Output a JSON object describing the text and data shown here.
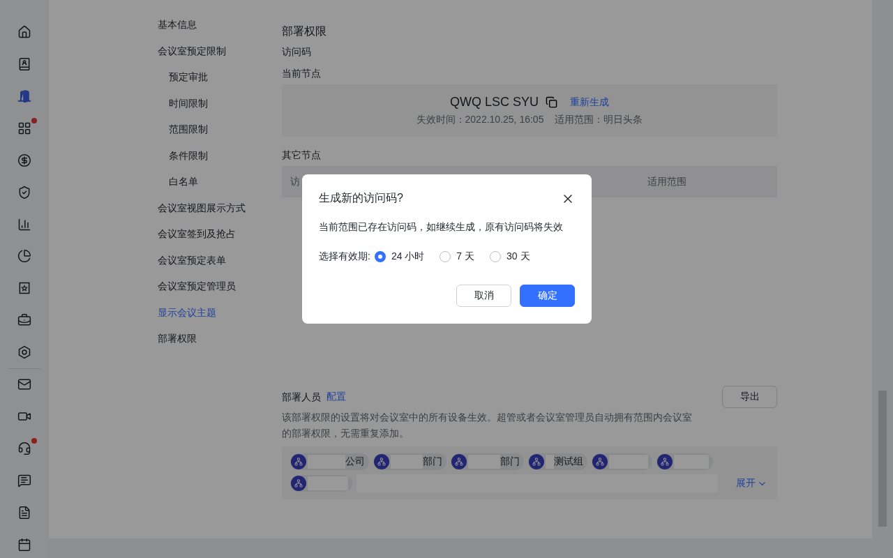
{
  "rail": {
    "items": [
      {
        "kind": "home",
        "selected": false,
        "badge": false
      },
      {
        "kind": "contacts",
        "selected": false,
        "badge": false
      },
      {
        "kind": "door",
        "selected": true,
        "badge": false
      },
      {
        "kind": "apps",
        "selected": false,
        "badge": true
      },
      {
        "kind": "money",
        "selected": false,
        "badge": false
      },
      {
        "kind": "shield",
        "selected": false,
        "badge": false
      },
      {
        "kind": "bars",
        "selected": false,
        "badge": false
      },
      {
        "kind": "pie",
        "selected": false,
        "badge": false
      },
      {
        "kind": "star",
        "selected": false,
        "badge": false
      },
      {
        "kind": "briefcase",
        "selected": false,
        "badge": false
      },
      {
        "kind": "hexagon",
        "selected": false,
        "badge": false
      },
      {
        "kind": "divider"
      },
      {
        "kind": "mail",
        "selected": false,
        "badge": false
      },
      {
        "kind": "video",
        "selected": false,
        "badge": false
      },
      {
        "kind": "headset",
        "selected": false,
        "badge": true
      },
      {
        "kind": "chat",
        "selected": false,
        "badge": false
      },
      {
        "kind": "report",
        "selected": false,
        "badge": false
      },
      {
        "kind": "calendar",
        "selected": false,
        "badge": false
      }
    ]
  },
  "nav": {
    "items": [
      {
        "label": "基本信息",
        "selected": false
      },
      {
        "label": "会议室预定限制",
        "selected": false,
        "children": [
          {
            "label": "预定审批",
            "selected": false
          },
          {
            "label": "时间限制",
            "selected": false
          },
          {
            "label": "范围限制",
            "selected": false
          },
          {
            "label": "条件限制",
            "selected": false
          },
          {
            "label": "白名单",
            "selected": false
          }
        ]
      },
      {
        "label": "会议室视图展示方式",
        "selected": false
      },
      {
        "label": "会议室签到及抢占",
        "selected": false
      },
      {
        "label": "会议室预定表单",
        "selected": false
      },
      {
        "label": "会议室预定管理员",
        "selected": false
      },
      {
        "label": "显示会议主题",
        "selected": true
      },
      {
        "label": "部署权限",
        "selected": false
      }
    ]
  },
  "section": {
    "title": "部署权限",
    "subtitle": "访问码",
    "current_node": {
      "label": "当前节点",
      "code": "QWQ LSC SYU",
      "regenerate": "重新生成",
      "expiry": "失效时间：2022.10.25, 16:05",
      "scope": "适用范围：明日头条"
    },
    "other_nodes": {
      "label": "其它节点",
      "columns": [
        "访",
        "适用范围"
      ]
    },
    "deploy": {
      "label": "部署人员",
      "config": "配置",
      "export": "导出",
      "description": "该部署权限的设置将对会议室中的所有设备生效。超管或者会议室管理员自动拥有范围内会议室的部署权限，无需重复添加。",
      "tags": [
        {
          "kind": "named",
          "label": "公司"
        },
        {
          "kind": "named",
          "label": "部门"
        },
        {
          "kind": "named",
          "label": "部门"
        },
        {
          "kind": "named",
          "label": "测试组"
        },
        {
          "kind": "masked"
        },
        {
          "kind": "masked"
        },
        {
          "kind": "masked"
        }
      ],
      "expand": "展开"
    }
  },
  "dialog": {
    "title": "生成新的访问码?",
    "message": "当前范围已存在访问码，如继续生成，原有访问码将失效",
    "period_label": "选择有效期:",
    "options": [
      {
        "label": "24 小时",
        "selected": true
      },
      {
        "label": "7 天",
        "selected": false
      },
      {
        "label": "30 天",
        "selected": false
      }
    ],
    "buttons": [
      {
        "label": "取消",
        "kind": "secondary"
      },
      {
        "label": "确定",
        "kind": "primary"
      }
    ]
  }
}
